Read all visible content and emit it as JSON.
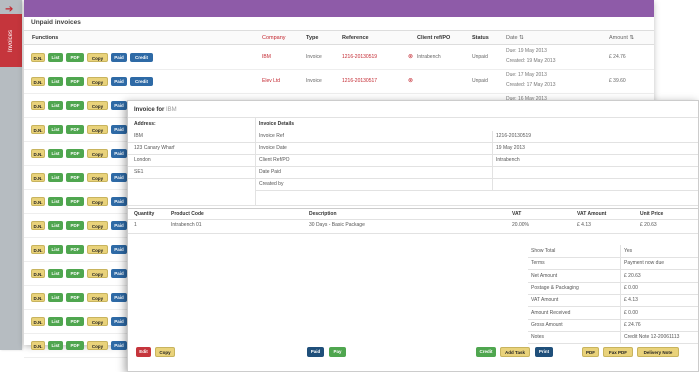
{
  "sidebar": {
    "arrow": "➔",
    "tab_label": "Invoices"
  },
  "list": {
    "title": "Unpaid invoices",
    "columns": {
      "functions": "Functions",
      "company": "Company",
      "type": "Type",
      "reference": "Reference",
      "client_ref": "Client ref/PO",
      "status": "Status",
      "date": "Date ⇅",
      "amount": "Amount ⇅"
    },
    "row_buttons": {
      "dn": "D.N.",
      "list": "List",
      "pdf": "PDF",
      "copy": "Copy",
      "paid": "Paid",
      "credit": "Credit"
    },
    "rows": [
      {
        "company": "IBM",
        "type": "Invoice",
        "reference": "1216-20130519",
        "client_ref": "Intrabench",
        "status": "Unpaid",
        "due": "Due: 19 May 2013",
        "created": "Created: 19 May 2013",
        "amount": "£ 24.76"
      },
      {
        "company": "Elev Ltd",
        "type": "Invoice",
        "reference": "1216-20130517",
        "client_ref": "",
        "status": "Unpaid",
        "due": "Due: 17 May 2013",
        "created": "Created: 17 May 2013",
        "amount": "£ 39.60"
      },
      {
        "company": "",
        "type": "",
        "reference": "",
        "client_ref": "",
        "status": "",
        "due": "Due: 16 May 2013",
        "created": "",
        "amount": ""
      },
      {
        "company": "",
        "type": "",
        "reference": "",
        "client_ref": "",
        "status": "",
        "due": "",
        "created": "",
        "amount": ""
      },
      {
        "company": "",
        "type": "",
        "reference": "",
        "client_ref": "",
        "status": "",
        "due": "",
        "created": "",
        "amount": ""
      },
      {
        "company": "",
        "type": "",
        "reference": "",
        "client_ref": "",
        "status": "",
        "due": "",
        "created": "",
        "amount": ""
      },
      {
        "company": "",
        "type": "",
        "reference": "",
        "client_ref": "",
        "status": "",
        "due": "",
        "created": "",
        "amount": ""
      },
      {
        "company": "",
        "type": "",
        "reference": "",
        "client_ref": "",
        "status": "",
        "due": "",
        "created": "",
        "amount": ""
      },
      {
        "company": "",
        "type": "",
        "reference": "",
        "client_ref": "",
        "status": "",
        "due": "",
        "created": "",
        "amount": ""
      },
      {
        "company": "",
        "type": "",
        "reference": "",
        "client_ref": "",
        "status": "",
        "due": "",
        "created": "",
        "amount": ""
      },
      {
        "company": "",
        "type": "",
        "reference": "",
        "client_ref": "",
        "status": "",
        "due": "",
        "created": "",
        "amount": ""
      },
      {
        "company": "",
        "type": "",
        "reference": "",
        "client_ref": "",
        "status": "",
        "due": "",
        "created": "",
        "amount": ""
      },
      {
        "company": "",
        "type": "",
        "reference": "",
        "client_ref": "",
        "status": "",
        "due": "",
        "created": "",
        "amount": ""
      }
    ]
  },
  "modal": {
    "title_prefix": "Invoice for",
    "company": "IBM",
    "address_heading": "Address:",
    "address_lines": [
      "IBM",
      "123 Canary Wharf",
      "London",
      "SE1"
    ],
    "details_heading": "Invoice Details",
    "details": [
      {
        "label": "Invoice Ref",
        "value": "1216-20130519"
      },
      {
        "label": "Invoice Date",
        "value": "19 May 2013"
      },
      {
        "label": "Client Ref/PO",
        "value": "Intrabench"
      },
      {
        "label": "Date Paid",
        "value": ""
      },
      {
        "label": "Created by",
        "value": ""
      }
    ],
    "items_headers": {
      "quantity": "Quantity",
      "product": "Product Code",
      "description": "Description",
      "vat": "VAT",
      "vat_amount": "VAT Amount",
      "unit_price": "Unit Price"
    },
    "items": [
      {
        "quantity": "1",
        "product": "Intrabench 01",
        "description": "30 Days - Basic Package",
        "vat": "20.00%",
        "vat_amount": "£ 4.13",
        "unit_price": "£ 20.63"
      }
    ],
    "totals": [
      {
        "label": "Show Total",
        "value": "Yes"
      },
      {
        "label": "Terms",
        "value": "Payment now due"
      },
      {
        "label": "Net Amount",
        "value": "£ 20.63"
      },
      {
        "label": "Postage & Packaging",
        "value": "£ 0.00"
      },
      {
        "label": "VAT Amount",
        "value": "£ 4.13"
      },
      {
        "label": "Amount Received",
        "value": "£ 0.00"
      },
      {
        "label": "Gross Amount",
        "value": "£ 24.76"
      },
      {
        "label": "Notes",
        "value": "Credit Note 12-20061113"
      }
    ],
    "footer_buttons": {
      "edit": "Edit",
      "copy": "Copy",
      "paid": "Paid",
      "pay": "Pay",
      "credit": "Credit",
      "add_task": "Add Task",
      "print": "Print",
      "pdf": "PDF",
      "fax_pdf": "Fax PDF",
      "delivery_note": "Delivery Note"
    }
  },
  "colors": {
    "purple_header": "#8e5ba8",
    "accent_red": "#c5353c",
    "button_green": "#4fa64f",
    "button_blue": "#2e6aa6",
    "button_yellow": "#e9d27a"
  }
}
